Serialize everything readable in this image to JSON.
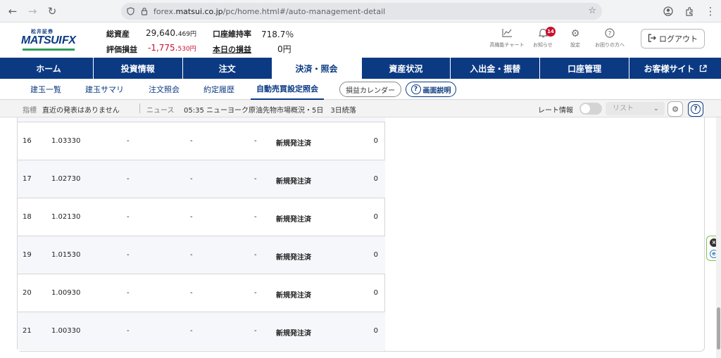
{
  "browser": {
    "url_prefix": "forex.",
    "url_domain": "matsui.co.jp",
    "url_path": "/pc/home.html#/auto-management-detail"
  },
  "header": {
    "logo_small": "松井証券",
    "logo_big_1": "MATSUI",
    "logo_big_2": "FX",
    "total_assets_label": "総資産",
    "total_assets_value": "29,640.",
    "total_assets_decimal": "469円",
    "margin_rate_label": "口座維持率",
    "margin_rate_value": "718.7％",
    "unrealized_label": "評価損益",
    "unrealized_value": "-1,775.",
    "unrealized_decimal": "530円",
    "today_pl_label": "本日の損益",
    "today_pl_value": "0円",
    "icons": [
      {
        "label": "高機能チャート"
      },
      {
        "label": "お知らせ",
        "badge": "14"
      },
      {
        "label": "設定"
      },
      {
        "label": "お困りの方へ"
      }
    ],
    "logout_label": "ログアウト"
  },
  "main_nav": [
    "ホーム",
    "投資情報",
    "注文",
    "決済・照会",
    "資産状況",
    "入出金・振替",
    "口座管理",
    "お客様サイト"
  ],
  "main_nav_active": 3,
  "sub_nav": {
    "items": [
      "建玉一覧",
      "建玉サマリ",
      "注文照会",
      "約定履歴",
      "自動売買設定照会"
    ],
    "active": 4,
    "calendar_label": "損益カレンダー",
    "help_label": "画面説明"
  },
  "ticker": {
    "indicator_label": "指標",
    "indicator_text": "直近の発表はありません",
    "news_label": "ニュース",
    "news_text": "05:35 ニューヨーク原油先物市場概況・5日　3日続落",
    "rate_label": "レート情報",
    "list_placeholder": "リスト"
  },
  "table": {
    "rows": [
      [
        "16",
        "1.03330",
        "-",
        "-",
        "-",
        "新規発注済",
        "0"
      ],
      [
        "17",
        "1.02730",
        "-",
        "-",
        "-",
        "新規発注済",
        "0"
      ],
      [
        "18",
        "1.02130",
        "-",
        "-",
        "-",
        "新規発注済",
        "0"
      ],
      [
        "19",
        "1.01530",
        "-",
        "-",
        "-",
        "新規発注済",
        "0"
      ],
      [
        "20",
        "1.00930",
        "-",
        "-",
        "-",
        "新規発注済",
        "0"
      ],
      [
        "21",
        "1.00330",
        "-",
        "-",
        "-",
        "新規発注済",
        "0"
      ]
    ]
  },
  "colors": {
    "brand_navy": "#0b3a83",
    "negative_red": "#c8102e",
    "badge_red": "#c8102e"
  }
}
